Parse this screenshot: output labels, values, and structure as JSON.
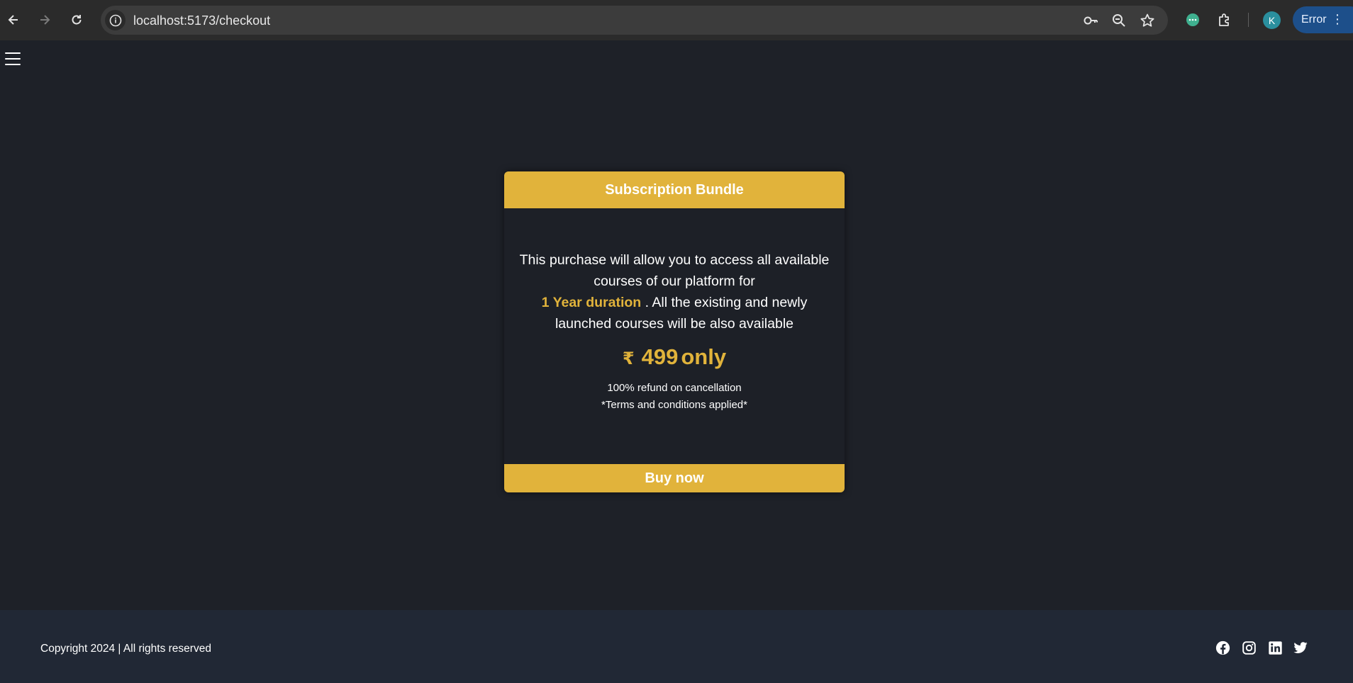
{
  "browser": {
    "url": "localhost:5173/checkout",
    "profile_initial": "K",
    "error_label": "Error",
    "icons": [
      "back-icon",
      "forward-icon",
      "reload-icon",
      "site-info-icon",
      "password-key-icon",
      "zoom-icon",
      "bookmark-star-icon",
      "extension-chat-icon",
      "extensions-puzzle-icon",
      "menu-dots-icon"
    ]
  },
  "card": {
    "title": "Subscription Bundle",
    "desc_part1": "This purchase will allow you to access all available courses of our platform for",
    "desc_highlight": "1 Year duration",
    "desc_part2": ". All the existing and newly launched courses will be also available",
    "currency_symbol": "₹",
    "price": "499",
    "price_suffix": "only",
    "refund_line": "100% refund on cancellation",
    "terms_line": "*Terms and conditions applied*",
    "buy_label": "Buy now"
  },
  "footer": {
    "copyright": "Copyright 2024 | All rights reserved",
    "social_icons": [
      "facebook-icon",
      "instagram-icon",
      "linkedin-icon",
      "twitter-icon"
    ]
  },
  "colors": {
    "accent": "#e1b33b",
    "page_bg": "#1e2128",
    "footer_bg": "#212835"
  }
}
